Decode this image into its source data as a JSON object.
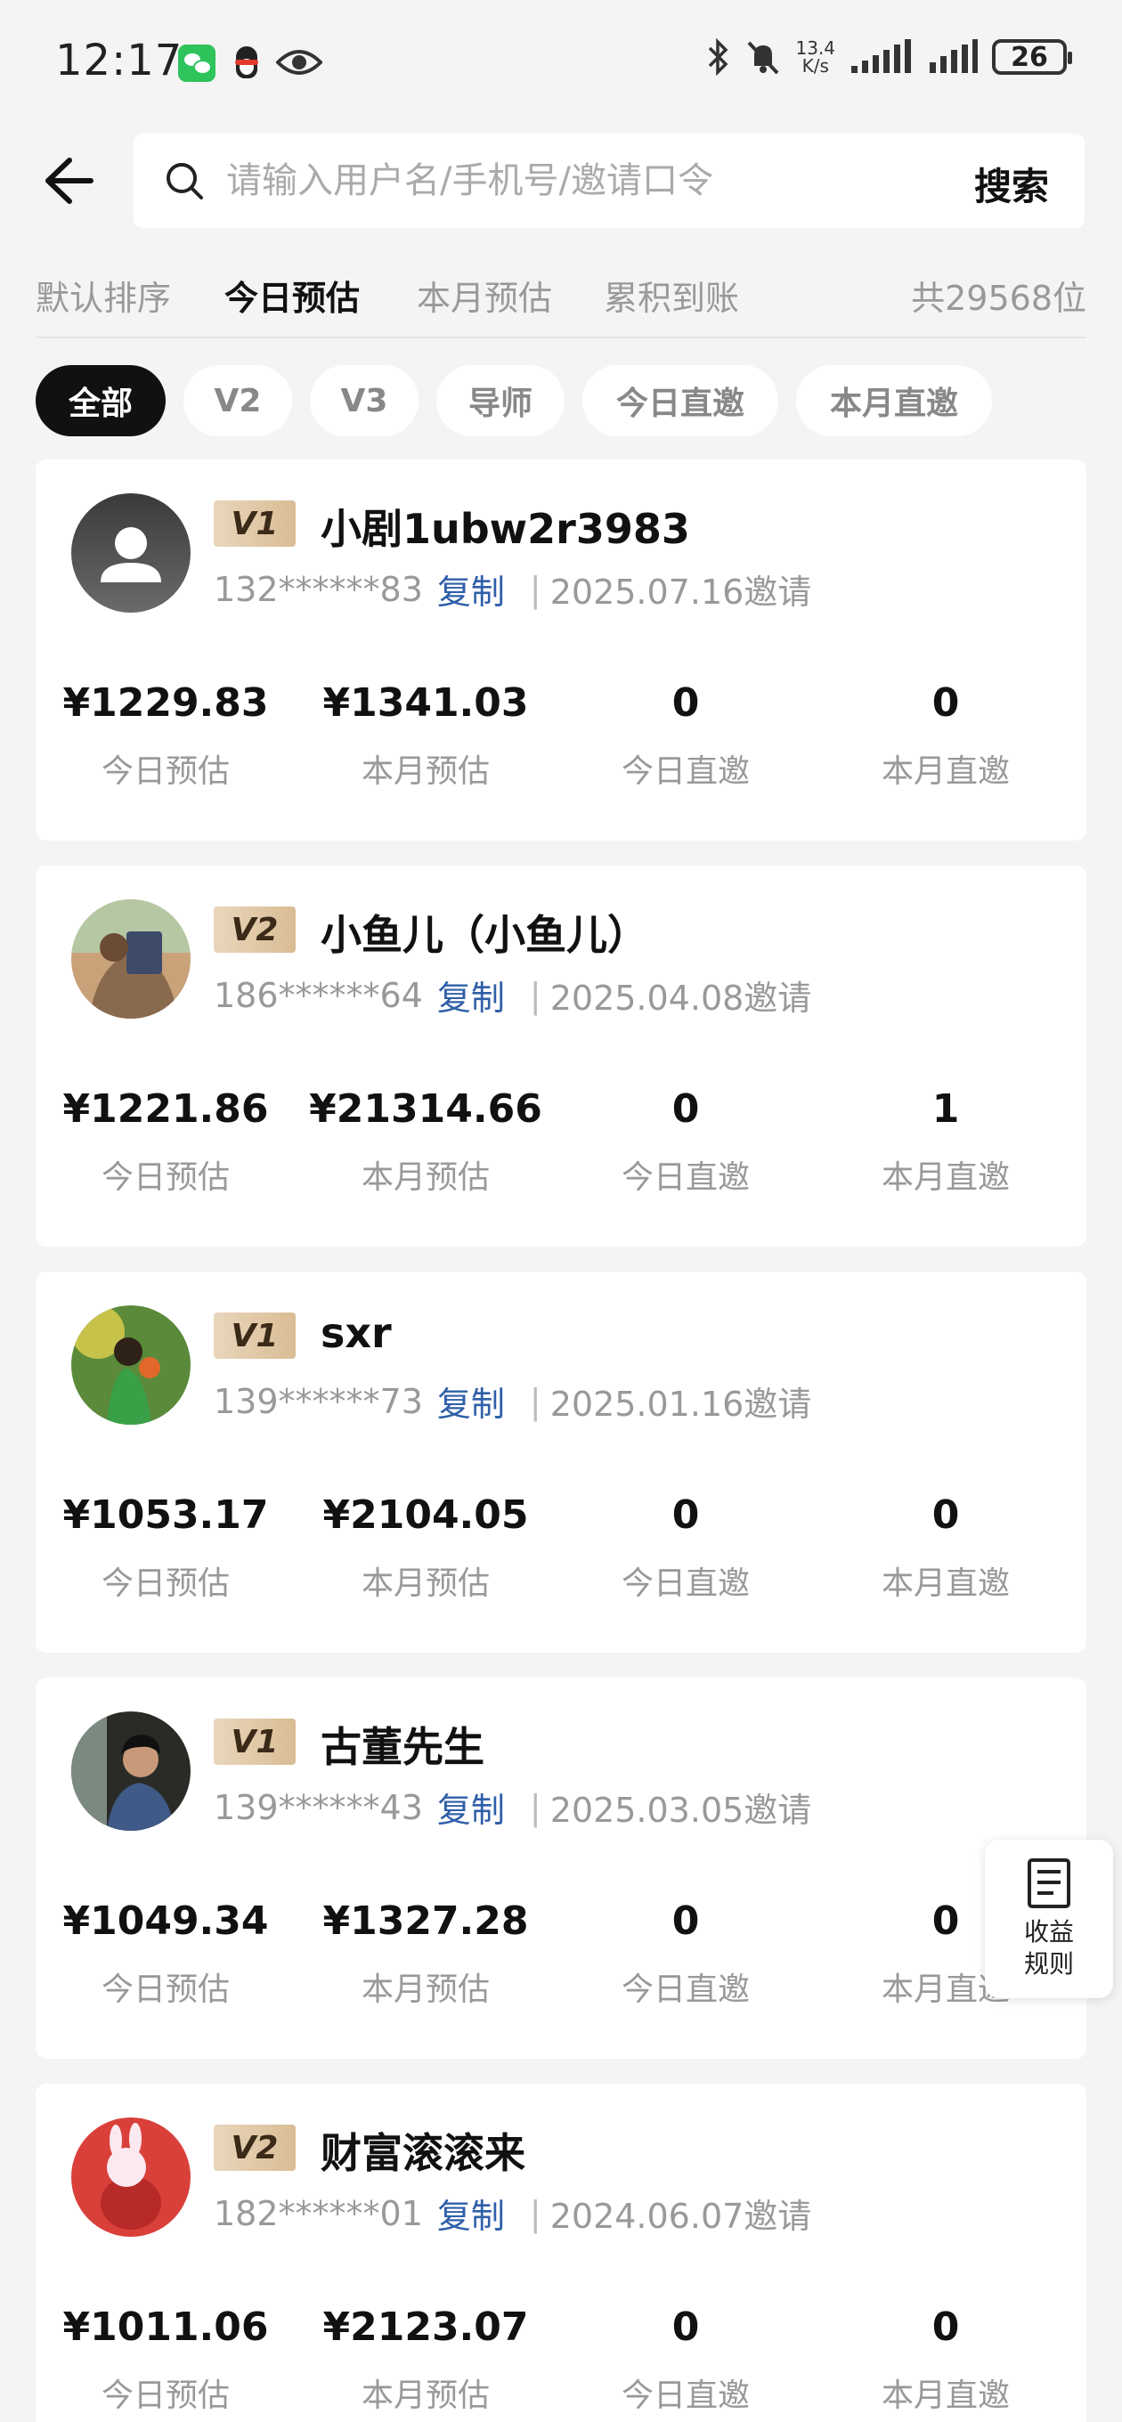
{
  "status_bar": {
    "time": "12:17",
    "net_speed_value": "13.4",
    "net_speed_unit": "K/s",
    "battery": "26"
  },
  "header": {
    "search_placeholder": "请输入用户名/手机号/邀请口令",
    "search_button": "搜索"
  },
  "sort_tabs": {
    "items": [
      "默认排序",
      "今日预估",
      "本月预估",
      "累积到账"
    ],
    "active": "今日预估",
    "total": "共29568位"
  },
  "filter_chips": {
    "items": [
      "全部",
      "V2",
      "V3",
      "导师",
      "今日直邀",
      "本月直邀"
    ],
    "active": "全部"
  },
  "stat_labels": [
    "今日预估",
    "本月预估",
    "今日直邀",
    "本月直邀"
  ],
  "copy_label": "复制",
  "members": [
    {
      "level": "V1",
      "name": "小剧1ubw2r3983",
      "phone": "132******83",
      "invite_date": "2025.07.16邀请",
      "today_estimate": "¥1229.83",
      "month_estimate": "¥1341.03",
      "today_direct": "0",
      "month_direct": "0"
    },
    {
      "level": "V2",
      "name": "小鱼儿（小鱼儿）",
      "phone": "186******64",
      "invite_date": "2025.04.08邀请",
      "today_estimate": "¥1221.86",
      "month_estimate": "¥21314.66",
      "today_direct": "0",
      "month_direct": "1"
    },
    {
      "level": "V1",
      "name": "sxr",
      "phone": "139******73",
      "invite_date": "2025.01.16邀请",
      "today_estimate": "¥1053.17",
      "month_estimate": "¥2104.05",
      "today_direct": "0",
      "month_direct": "0"
    },
    {
      "level": "V1",
      "name": "古董先生",
      "phone": "139******43",
      "invite_date": "2025.03.05邀请",
      "today_estimate": "¥1049.34",
      "month_estimate": "¥1327.28",
      "today_direct": "0",
      "month_direct": "0"
    },
    {
      "level": "V2",
      "name": "财富滚滚来",
      "phone": "182******01",
      "invite_date": "2024.06.07邀请",
      "today_estimate": "¥1011.06",
      "month_estimate": "¥2123.07",
      "today_direct": "0",
      "month_direct": "0"
    }
  ],
  "rules_button": {
    "line1": "收益",
    "line2": "规则"
  },
  "colors": {
    "accent_link": "#2f5fa8",
    "badge_gold": "#d9bc94",
    "chip_active": "#111111"
  }
}
